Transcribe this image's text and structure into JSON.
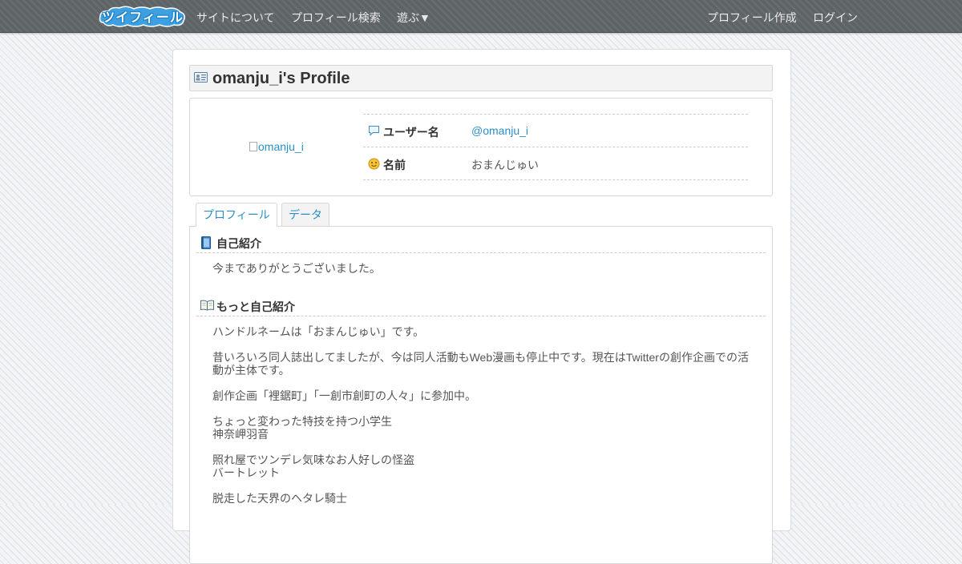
{
  "nav": {
    "logo_text": "ツイフィール",
    "about": "サイトについて",
    "search": "プロフィール検索",
    "play": "遊ぶ▼",
    "create": "プロフィール作成",
    "login": "ログイン"
  },
  "profile": {
    "title": "omanju_i's Profile",
    "avatar_alt": "omanju_i",
    "username_label": "ユーザー名",
    "username_value": "@omanju_i",
    "name_label": "名前",
    "name_value": "おまんじゅい"
  },
  "tabs": {
    "profile": "プロフィール",
    "data": "データ"
  },
  "sections": {
    "intro_title": "自己紹介",
    "intro_text": "今までありがとうございました。",
    "more_title": "もっと自己紹介",
    "more_paragraphs": [
      "ハンドルネームは「おまんじゅい」です。",
      "昔いろいろ同人誌出してましたが、今は同人活動もWeb漫画も停止中です。現在はTwitterの創作企画での活動が主体です。",
      "創作企画「裡鋸町」「一創市創町の人々」に参加中。",
      "ちょっと変わった特技を持つ小学生\n神奈岬羽音",
      "照れ屋でツンデレ気味なお人好しの怪盗\nバートレット",
      "脱走した天界のヘタレ騎士"
    ]
  },
  "colors": {
    "link": "#2a8fc7",
    "nav_bg": "#5e6366",
    "logo_bg": "#3ea0e0"
  }
}
